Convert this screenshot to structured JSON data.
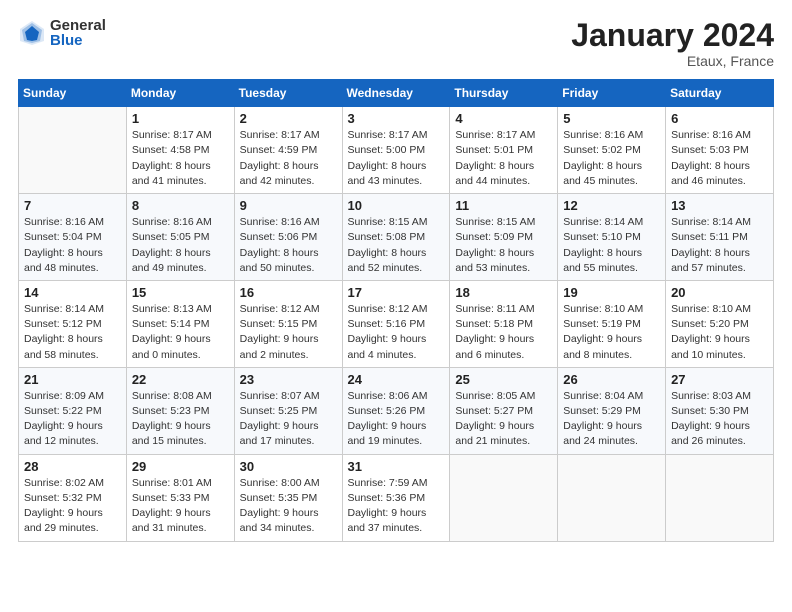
{
  "header": {
    "logo_general": "General",
    "logo_blue": "Blue",
    "month_title": "January 2024",
    "location": "Etaux, France"
  },
  "weekdays": [
    "Sunday",
    "Monday",
    "Tuesday",
    "Wednesday",
    "Thursday",
    "Friday",
    "Saturday"
  ],
  "weeks": [
    [
      {
        "day": "",
        "info": ""
      },
      {
        "day": "1",
        "info": "Sunrise: 8:17 AM\nSunset: 4:58 PM\nDaylight: 8 hours\nand 41 minutes."
      },
      {
        "day": "2",
        "info": "Sunrise: 8:17 AM\nSunset: 4:59 PM\nDaylight: 8 hours\nand 42 minutes."
      },
      {
        "day": "3",
        "info": "Sunrise: 8:17 AM\nSunset: 5:00 PM\nDaylight: 8 hours\nand 43 minutes."
      },
      {
        "day": "4",
        "info": "Sunrise: 8:17 AM\nSunset: 5:01 PM\nDaylight: 8 hours\nand 44 minutes."
      },
      {
        "day": "5",
        "info": "Sunrise: 8:16 AM\nSunset: 5:02 PM\nDaylight: 8 hours\nand 45 minutes."
      },
      {
        "day": "6",
        "info": "Sunrise: 8:16 AM\nSunset: 5:03 PM\nDaylight: 8 hours\nand 46 minutes."
      }
    ],
    [
      {
        "day": "7",
        "info": "Sunrise: 8:16 AM\nSunset: 5:04 PM\nDaylight: 8 hours\nand 48 minutes."
      },
      {
        "day": "8",
        "info": "Sunrise: 8:16 AM\nSunset: 5:05 PM\nDaylight: 8 hours\nand 49 minutes."
      },
      {
        "day": "9",
        "info": "Sunrise: 8:16 AM\nSunset: 5:06 PM\nDaylight: 8 hours\nand 50 minutes."
      },
      {
        "day": "10",
        "info": "Sunrise: 8:15 AM\nSunset: 5:08 PM\nDaylight: 8 hours\nand 52 minutes."
      },
      {
        "day": "11",
        "info": "Sunrise: 8:15 AM\nSunset: 5:09 PM\nDaylight: 8 hours\nand 53 minutes."
      },
      {
        "day": "12",
        "info": "Sunrise: 8:14 AM\nSunset: 5:10 PM\nDaylight: 8 hours\nand 55 minutes."
      },
      {
        "day": "13",
        "info": "Sunrise: 8:14 AM\nSunset: 5:11 PM\nDaylight: 8 hours\nand 57 minutes."
      }
    ],
    [
      {
        "day": "14",
        "info": "Sunrise: 8:14 AM\nSunset: 5:12 PM\nDaylight: 8 hours\nand 58 minutes."
      },
      {
        "day": "15",
        "info": "Sunrise: 8:13 AM\nSunset: 5:14 PM\nDaylight: 9 hours\nand 0 minutes."
      },
      {
        "day": "16",
        "info": "Sunrise: 8:12 AM\nSunset: 5:15 PM\nDaylight: 9 hours\nand 2 minutes."
      },
      {
        "day": "17",
        "info": "Sunrise: 8:12 AM\nSunset: 5:16 PM\nDaylight: 9 hours\nand 4 minutes."
      },
      {
        "day": "18",
        "info": "Sunrise: 8:11 AM\nSunset: 5:18 PM\nDaylight: 9 hours\nand 6 minutes."
      },
      {
        "day": "19",
        "info": "Sunrise: 8:10 AM\nSunset: 5:19 PM\nDaylight: 9 hours\nand 8 minutes."
      },
      {
        "day": "20",
        "info": "Sunrise: 8:10 AM\nSunset: 5:20 PM\nDaylight: 9 hours\nand 10 minutes."
      }
    ],
    [
      {
        "day": "21",
        "info": "Sunrise: 8:09 AM\nSunset: 5:22 PM\nDaylight: 9 hours\nand 12 minutes."
      },
      {
        "day": "22",
        "info": "Sunrise: 8:08 AM\nSunset: 5:23 PM\nDaylight: 9 hours\nand 15 minutes."
      },
      {
        "day": "23",
        "info": "Sunrise: 8:07 AM\nSunset: 5:25 PM\nDaylight: 9 hours\nand 17 minutes."
      },
      {
        "day": "24",
        "info": "Sunrise: 8:06 AM\nSunset: 5:26 PM\nDaylight: 9 hours\nand 19 minutes."
      },
      {
        "day": "25",
        "info": "Sunrise: 8:05 AM\nSunset: 5:27 PM\nDaylight: 9 hours\nand 21 minutes."
      },
      {
        "day": "26",
        "info": "Sunrise: 8:04 AM\nSunset: 5:29 PM\nDaylight: 9 hours\nand 24 minutes."
      },
      {
        "day": "27",
        "info": "Sunrise: 8:03 AM\nSunset: 5:30 PM\nDaylight: 9 hours\nand 26 minutes."
      }
    ],
    [
      {
        "day": "28",
        "info": "Sunrise: 8:02 AM\nSunset: 5:32 PM\nDaylight: 9 hours\nand 29 minutes."
      },
      {
        "day": "29",
        "info": "Sunrise: 8:01 AM\nSunset: 5:33 PM\nDaylight: 9 hours\nand 31 minutes."
      },
      {
        "day": "30",
        "info": "Sunrise: 8:00 AM\nSunset: 5:35 PM\nDaylight: 9 hours\nand 34 minutes."
      },
      {
        "day": "31",
        "info": "Sunrise: 7:59 AM\nSunset: 5:36 PM\nDaylight: 9 hours\nand 37 minutes."
      },
      {
        "day": "",
        "info": ""
      },
      {
        "day": "",
        "info": ""
      },
      {
        "day": "",
        "info": ""
      }
    ]
  ]
}
